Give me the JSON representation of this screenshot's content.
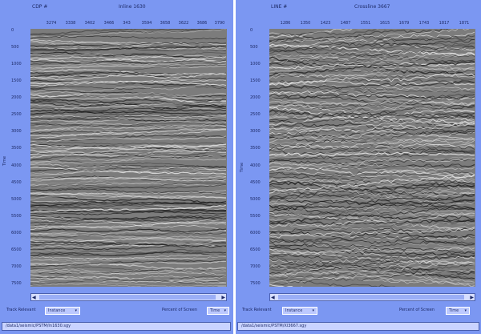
{
  "left": {
    "header_id": "CDP #",
    "title": "Inline 1630",
    "x_ticks": [
      "3274",
      "3338",
      "3402",
      "3466",
      "343",
      "3594",
      "3658",
      "3622",
      "3686",
      "3790"
    ],
    "y_ticks": [
      "0",
      "500",
      "1000",
      "1500",
      "2000",
      "2500",
      "3000",
      "3500",
      "4000",
      "4500",
      "5000",
      "5500",
      "6000",
      "6500",
      "7000",
      "7500"
    ],
    "y_label": "Time",
    "trace_label": "Track Relevant",
    "trace_value": "Instance",
    "scroll_label": "Percent of Screen",
    "scroll_value": "Time",
    "path": "/data1/seismic/PSTM/In1630.sgy"
  },
  "right": {
    "header_id": "LINE #",
    "title": "Crossline 3667",
    "x_ticks": [
      "1286",
      "1350",
      "1423",
      "1487",
      "1551",
      "1615",
      "1679",
      "1743",
      "1817",
      "1871"
    ],
    "y_ticks": [
      "0",
      "500",
      "1000",
      "1500",
      "2000",
      "2500",
      "3000",
      "3500",
      "4000",
      "4500",
      "5000",
      "5500",
      "6000",
      "6500",
      "7000",
      "7500"
    ],
    "y_label": "Time",
    "trace_label": "Track Relevant",
    "trace_value": "Instance",
    "scroll_label": "Percent of Screen",
    "scroll_value": "Time",
    "path": "/data1/seismic/PSTM/Xl3667.sgy"
  },
  "icons": {
    "left_arrow": "left-arrow-icon",
    "right_arrow": "right-arrow-icon",
    "menu_caret": "caret-down-icon"
  }
}
